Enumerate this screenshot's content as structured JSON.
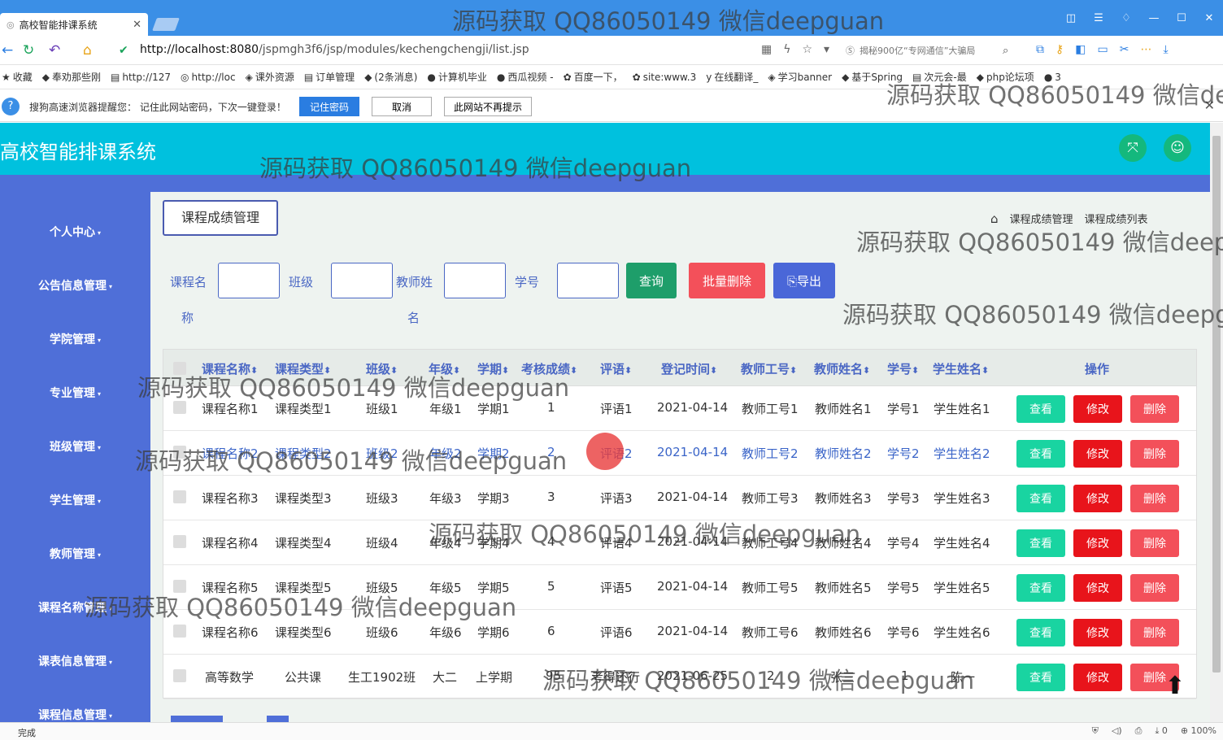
{
  "browser": {
    "tab_title": "高校智能排课系统",
    "url_host": "http://localhost:8080",
    "url_path": "/jspmgh3f6/jsp/modules/kechengchengji/list.jsp",
    "search_text": "揭秘900亿“专网通信”大骗局",
    "bookmarks": [
      "收藏",
      "奉劝那些刚",
      "http://127",
      "http://loc",
      "课外资源",
      "订单管理",
      "(2条消息)",
      "计算机毕业",
      "西瓜视频 -",
      "百度一下，",
      "site:www.3",
      "在线翻译_",
      "学习banner",
      "基于Spring",
      "次元会-最",
      "php论坛项",
      "3"
    ],
    "password_prompt": {
      "message": "搜狗高速浏览器提醒您：  记住此网站密码，下次一键登录！",
      "remember": "记住密码",
      "cancel": "取消",
      "never": "此网站不再提示"
    },
    "status_text": "完成",
    "status_count": "0",
    "zoom": "100%"
  },
  "app": {
    "title": "高校智能排课系统"
  },
  "sidebar": {
    "items": [
      {
        "label": "个人中心"
      },
      {
        "label": "公告信息管理"
      },
      {
        "label": "学院管理"
      },
      {
        "label": "专业管理"
      },
      {
        "label": "班级管理"
      },
      {
        "label": "学生管理"
      },
      {
        "label": "教师管理"
      },
      {
        "label": "课程名称管理"
      },
      {
        "label": "课表信息管理"
      },
      {
        "label": "课程信息管理"
      }
    ]
  },
  "page": {
    "title": "课程成绩管理",
    "breadcrumb": [
      "课程成绩管理",
      "课程成绩列表"
    ]
  },
  "filters": {
    "course_label": "课程名称",
    "class_label": "班级",
    "teacher_label": "教师姓名",
    "student_no_label": "学号",
    "query": "查询",
    "batch_delete": "批量删除",
    "export": "导出"
  },
  "table": {
    "headers": [
      "课程名称",
      "课程类型",
      "班级",
      "年级",
      "学期",
      "考核成绩",
      "评语",
      "登记时间",
      "教师工号",
      "教师姓名",
      "学号",
      "学生姓名",
      "操作"
    ],
    "actions": {
      "view": "查看",
      "edit": "修改",
      "delete": "删除"
    },
    "rows": [
      [
        "课程名称1",
        "课程类型1",
        "班级1",
        "年级1",
        "学期1",
        "1",
        "评语1",
        "2021-04-14",
        "教师工号1",
        "教师姓名1",
        "学号1",
        "学生姓名1"
      ],
      [
        "课程名称2",
        "课程类型2",
        "班级2",
        "年级2",
        "学期2",
        "2",
        "评语2",
        "2021-04-14",
        "教师工号2",
        "教师姓名2",
        "学号2",
        "学生姓名2"
      ],
      [
        "课程名称3",
        "课程类型3",
        "班级3",
        "年级3",
        "学期3",
        "3",
        "评语3",
        "2021-04-14",
        "教师工号3",
        "教师姓名3",
        "学号3",
        "学生姓名3"
      ],
      [
        "课程名称4",
        "课程类型4",
        "班级4",
        "年级4",
        "学期4",
        "4",
        "评语4",
        "2021-04-14",
        "教师工号4",
        "教师姓名4",
        "学号4",
        "学生姓名4"
      ],
      [
        "课程名称5",
        "课程类型5",
        "班级5",
        "年级5",
        "学期5",
        "5",
        "评语5",
        "2021-04-14",
        "教师工号5",
        "教师姓名5",
        "学号5",
        "学生姓名5"
      ],
      [
        "课程名称6",
        "课程类型6",
        "班级6",
        "年级6",
        "学期6",
        "6",
        "评语6",
        "2021-04-14",
        "教师工号6",
        "教师姓名6",
        "学号6",
        "学生姓名6"
      ],
      [
        "高等数学",
        "公共课",
        "生工1902班",
        "大二",
        "上学期",
        "95",
        "考得还行",
        "2021-06-25",
        "2",
        "张三",
        "1",
        "陈一"
      ]
    ]
  },
  "watermark": "源码获取 QQ86050149 微信deepguan",
  "colors": {
    "header": "#00c1de",
    "sidebar": "#4f6fd8",
    "view": "#19d4a1",
    "edit": "#e8141b",
    "delete": "#f3505a",
    "query": "#1e9e6a",
    "batch_delete": "#f3505a",
    "export": "#4a67d8"
  }
}
